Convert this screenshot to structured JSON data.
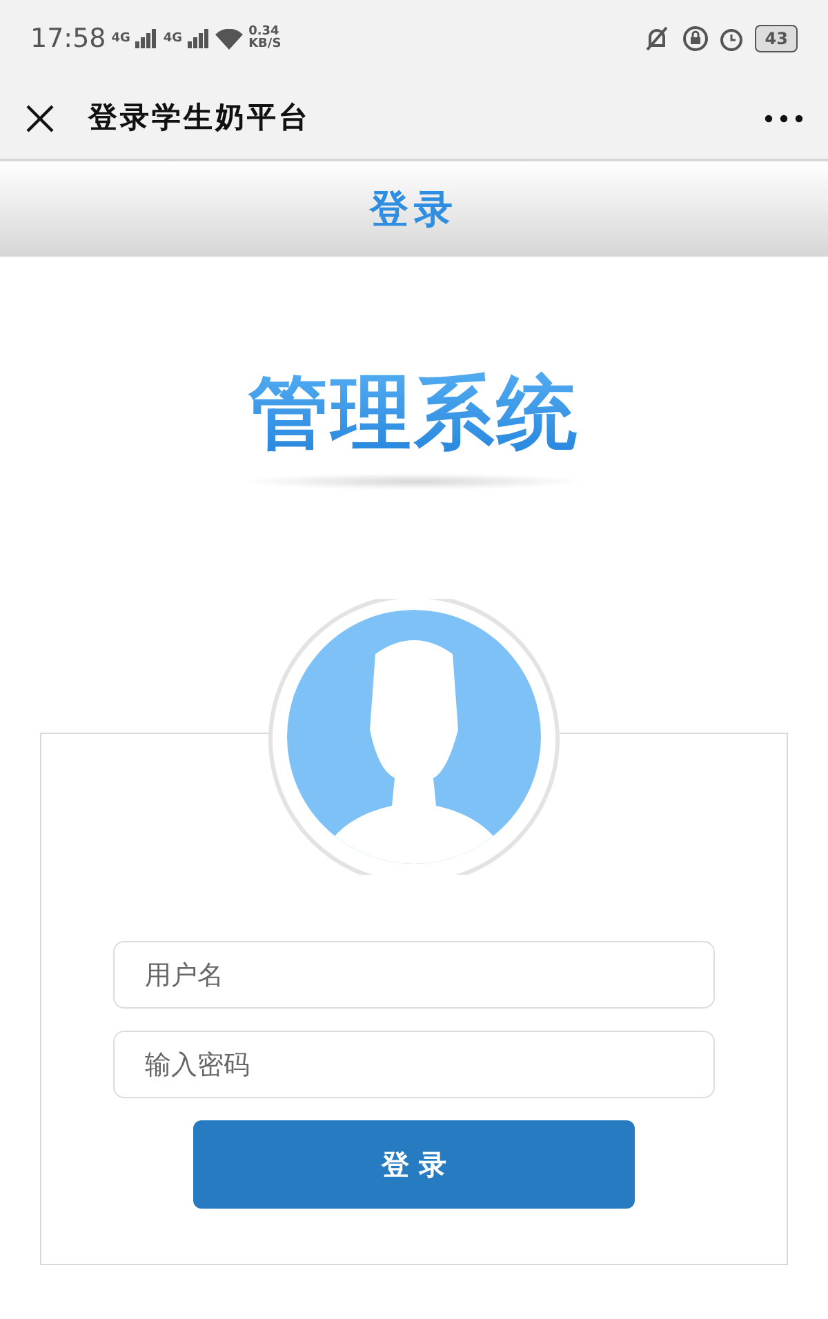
{
  "status_bar": {
    "time": "17:58",
    "network": [
      "4G",
      "4G"
    ],
    "speed": "0.34",
    "speed_unit": "KB/S",
    "battery": "43"
  },
  "window": {
    "title": "登录学生奶平台"
  },
  "header": {
    "title": "登录"
  },
  "logo": {
    "text": "管理系统"
  },
  "form": {
    "fields": [
      {
        "placeholder": "用户名"
      },
      {
        "placeholder": "输入密码"
      }
    ],
    "submit": "登 录"
  }
}
